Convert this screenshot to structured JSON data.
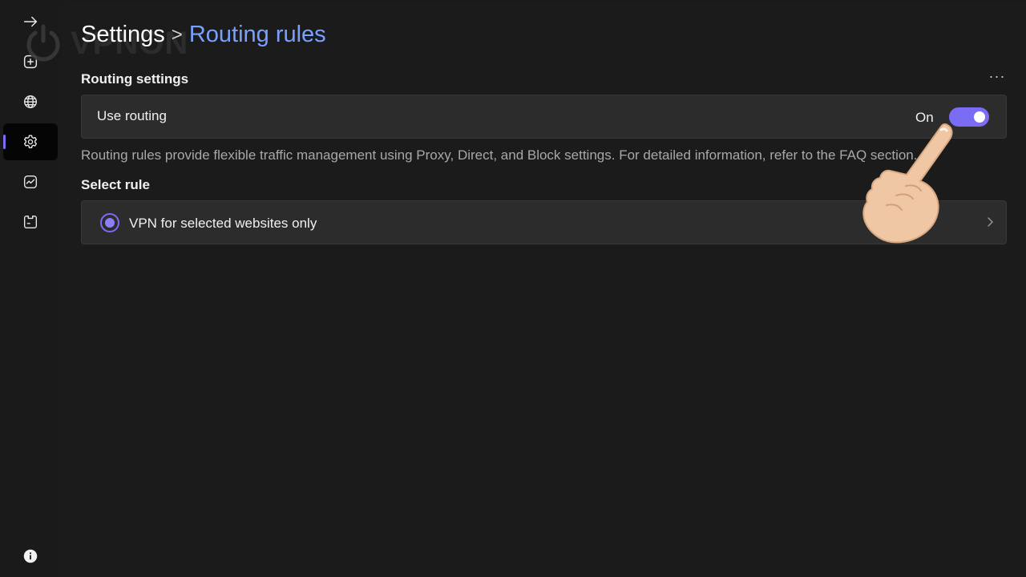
{
  "logo": {
    "text": "VPNON"
  },
  "breadcrumb": {
    "root": "Settings",
    "separator": ">",
    "current": "Routing rules"
  },
  "sidebar": {
    "items": [
      {
        "name": "collapse",
        "icon": "arrow-right-icon",
        "active": false
      },
      {
        "name": "add",
        "icon": "plus-square-icon",
        "active": false
      },
      {
        "name": "servers",
        "icon": "globe-icon",
        "active": false
      },
      {
        "name": "settings",
        "icon": "gear-icon",
        "active": true
      },
      {
        "name": "statistics",
        "icon": "chart-icon",
        "active": false
      },
      {
        "name": "logs",
        "icon": "clipboard-icon",
        "active": false
      },
      {
        "name": "info",
        "icon": "info-icon",
        "active": false
      }
    ]
  },
  "routing_settings": {
    "title": "Routing settings",
    "more_label": "···",
    "use_routing": {
      "label": "Use routing",
      "state_label": "On",
      "enabled": true
    },
    "description": "Routing rules provide flexible traffic management using Proxy, Direct, and Block settings. For detailed information, refer to the FAQ section."
  },
  "select_rule": {
    "title": "Select rule",
    "selected_rule": "VPN for selected websites only",
    "selected": true
  },
  "colors": {
    "accent": "#7b6cf6",
    "link": "#7aa0ff",
    "background": "#1a1a1a",
    "card": "#2c2c2c"
  }
}
